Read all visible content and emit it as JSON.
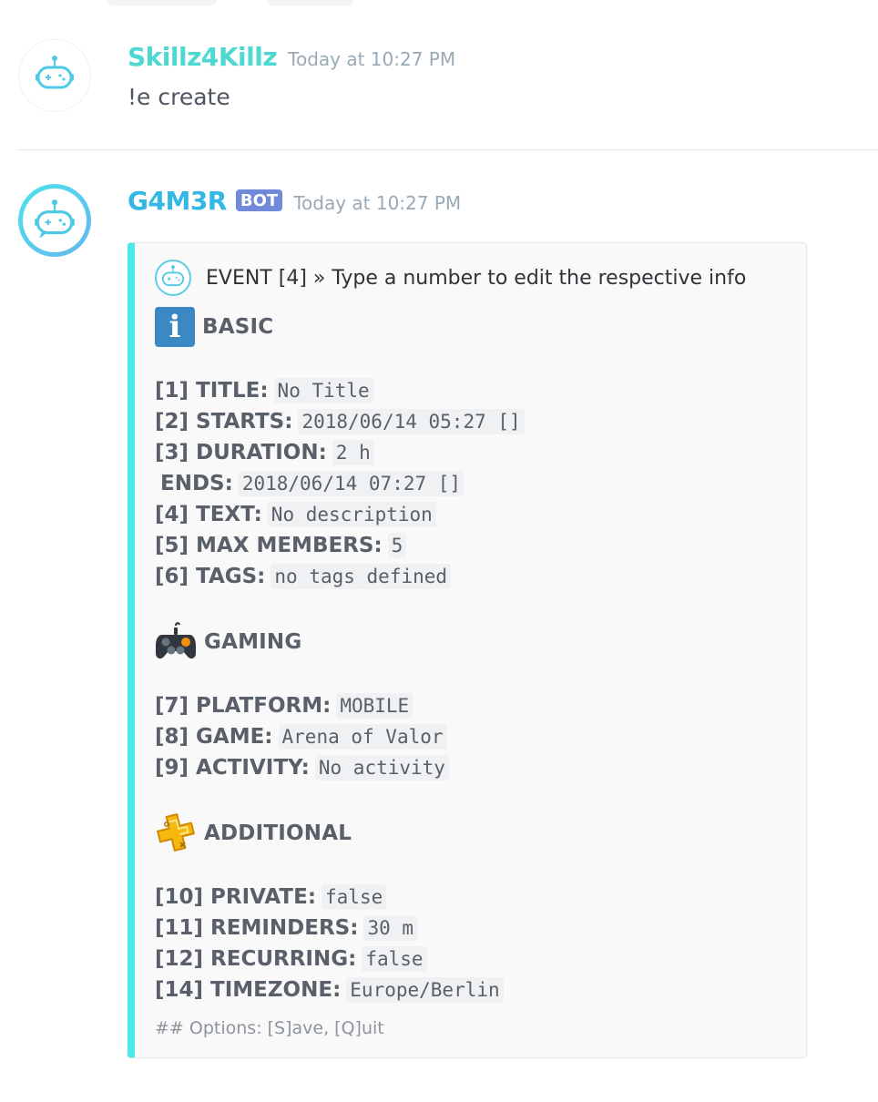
{
  "messages": [
    {
      "username": "Skillz4Killz",
      "timestamp": "Today at 10:27 PM",
      "text": "!e create"
    },
    {
      "username": "G4M3R",
      "badge": "BOT",
      "timestamp": "Today at 10:27 PM"
    }
  ],
  "embed": {
    "accent_color": "#4de8e8",
    "author_text": "EVENT [4] » Type a number to edit the respective info",
    "sections": [
      {
        "title": "BASIC",
        "icon": "info-icon",
        "fields": [
          {
            "label": "[1] TITLE:",
            "value": "No Title"
          },
          {
            "label": "[2] STARTS:",
            "value": "2018/06/14 05:27 []"
          },
          {
            "label": "[3] DURATION:",
            "value": "2 h"
          },
          {
            "label": "ENDS:",
            "value": "2018/06/14 07:27 []"
          },
          {
            "label": "[4] TEXT:",
            "value": "No description"
          },
          {
            "label": "[5] MAX MEMBERS:",
            "value": "5"
          },
          {
            "label": "[6] TAGS:",
            "value": "no tags defined"
          }
        ]
      },
      {
        "title": "GAMING",
        "icon": "gamepad-icon",
        "fields": [
          {
            "label": "[7] PLATFORM:",
            "value": "MOBILE"
          },
          {
            "label": "[8] GAME:",
            "value": "Arena of Valor"
          },
          {
            "label": "[9] ACTIVITY:",
            "value": "No activity"
          }
        ]
      },
      {
        "title": "ADDITIONAL",
        "icon": "playstation-plus-icon",
        "fields": [
          {
            "label": "[10] PRIVATE:",
            "value": "false"
          },
          {
            "label": "[11] REMINDERS:",
            "value": "30 m"
          },
          {
            "label": "[12] RECURRING:",
            "value": "false"
          },
          {
            "label": "[14] TIMEZONE:",
            "value": "Europe/Berlin"
          }
        ]
      }
    ],
    "footer": "## Options: [S]ave, [Q]uit"
  }
}
